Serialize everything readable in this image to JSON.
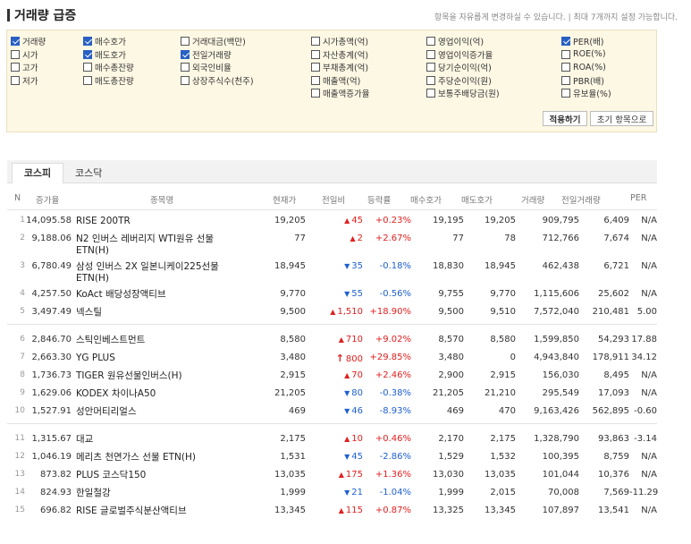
{
  "header": {
    "title": "거래량 급증",
    "hint": "항목을 자유롭게 변경하실 수 있습니다.  |  최대 7개까지 설정 가능합니다."
  },
  "filters": {
    "columns": [
      [
        {
          "label": "거래량",
          "checked": true
        },
        {
          "label": "시가",
          "checked": false
        },
        {
          "label": "고가",
          "checked": false
        },
        {
          "label": "저가",
          "checked": false
        }
      ],
      [
        {
          "label": "매수호가",
          "checked": true
        },
        {
          "label": "매도호가",
          "checked": true
        },
        {
          "label": "매수총잔량",
          "checked": false
        },
        {
          "label": "매도총잔량",
          "checked": false
        }
      ],
      [
        {
          "label": "거래대금(백만)",
          "checked": false
        },
        {
          "label": "전일거래량",
          "checked": true
        },
        {
          "label": "외국인비율",
          "checked": false
        },
        {
          "label": "상장주식수(천주)",
          "checked": false
        }
      ],
      [
        {
          "label": "시가총액(억)",
          "checked": false
        },
        {
          "label": "자산총계(억)",
          "checked": false
        },
        {
          "label": "부채총계(억)",
          "checked": false
        },
        {
          "label": "매출액(억)",
          "checked": false
        },
        {
          "label": "매출액증가율",
          "checked": false
        }
      ],
      [
        {
          "label": "영업이익(억)",
          "checked": false
        },
        {
          "label": "영업이익증가율",
          "checked": false
        },
        {
          "label": "당기순이익(억)",
          "checked": false
        },
        {
          "label": "주당순이익(원)",
          "checked": false
        },
        {
          "label": "보통주배당금(원)",
          "checked": false
        }
      ],
      [
        {
          "label": "PER(배)",
          "checked": true
        },
        {
          "label": "ROE(%)",
          "checked": false
        },
        {
          "label": "ROA(%)",
          "checked": false
        },
        {
          "label": "PBR(배)",
          "checked": false
        },
        {
          "label": "유보율(%)",
          "checked": false
        }
      ]
    ],
    "apply_label": "적용하기",
    "reset_label": "초기 항목으로"
  },
  "tabs": [
    {
      "label": "코스피",
      "active": true
    },
    {
      "label": "코스닥",
      "active": false
    }
  ],
  "table": {
    "headers": {
      "n": "N",
      "rate": "증가율",
      "name": "종목명",
      "price": "현재가",
      "chg": "전일비",
      "pct": "등락률",
      "bid": "매수호가",
      "ask": "매도호가",
      "vol": "거래량",
      "pvol": "전일거래량",
      "per": "PER"
    },
    "rows": [
      {
        "n": "1",
        "rate": "14,095.58",
        "name": "RISE 200TR",
        "price": "19,205",
        "dir": "up",
        "chg": "45",
        "pct": "+0.23%",
        "bid": "19,195",
        "ask": "19,205",
        "vol": "909,795",
        "pvol": "6,409",
        "per": "N/A"
      },
      {
        "n": "2",
        "rate": "9,188.06",
        "name": "N2 인버스 레버리지 WTI원유 선물 ETN(H)",
        "price": "77",
        "dir": "up",
        "chg": "2",
        "pct": "+2.67%",
        "bid": "77",
        "ask": "78",
        "vol": "712,766",
        "pvol": "7,674",
        "per": "N/A"
      },
      {
        "n": "3",
        "rate": "6,780.49",
        "name": "삼성 인버스 2X 일본니케이225선물 ETN(H)",
        "price": "18,945",
        "dir": "down",
        "chg": "35",
        "pct": "-0.18%",
        "bid": "18,830",
        "ask": "18,945",
        "vol": "462,438",
        "pvol": "6,721",
        "per": "N/A"
      },
      {
        "n": "4",
        "rate": "4,257.50",
        "name": "KoAct 배당성장액티브",
        "price": "9,770",
        "dir": "down",
        "chg": "55",
        "pct": "-0.56%",
        "bid": "9,755",
        "ask": "9,770",
        "vol": "1,115,606",
        "pvol": "25,602",
        "per": "N/A"
      },
      {
        "n": "5",
        "rate": "3,497.49",
        "name": "넥스틸",
        "price": "9,500",
        "dir": "up",
        "chg": "1,510",
        "pct": "+18.90%",
        "bid": "9,500",
        "ask": "9,510",
        "vol": "7,572,040",
        "pvol": "210,481",
        "per": "5.00"
      },
      {
        "n": "6",
        "rate": "2,846.70",
        "name": "스틱인베스트먼트",
        "price": "8,580",
        "dir": "up",
        "chg": "710",
        "pct": "+9.02%",
        "bid": "8,570",
        "ask": "8,580",
        "vol": "1,599,850",
        "pvol": "54,293",
        "per": "17.88"
      },
      {
        "n": "7",
        "rate": "2,663.30",
        "name": "YG PLUS",
        "price": "3,480",
        "dir": "limit",
        "chg": "800",
        "pct": "+29.85%",
        "bid": "3,480",
        "ask": "0",
        "vol": "4,943,840",
        "pvol": "178,911",
        "per": "34.12"
      },
      {
        "n": "8",
        "rate": "1,736.73",
        "name": "TIGER 원유선물인버스(H)",
        "price": "2,915",
        "dir": "up",
        "chg": "70",
        "pct": "+2.46%",
        "bid": "2,900",
        "ask": "2,915",
        "vol": "156,030",
        "pvol": "8,495",
        "per": "N/A"
      },
      {
        "n": "9",
        "rate": "1,629.06",
        "name": "KODEX 차이나A50",
        "price": "21,205",
        "dir": "down",
        "chg": "80",
        "pct": "-0.38%",
        "bid": "21,205",
        "ask": "21,210",
        "vol": "295,549",
        "pvol": "17,093",
        "per": "N/A"
      },
      {
        "n": "10",
        "rate": "1,527.91",
        "name": "성안머티리얼스",
        "price": "469",
        "dir": "down",
        "chg": "46",
        "pct": "-8.93%",
        "bid": "469",
        "ask": "470",
        "vol": "9,163,426",
        "pvol": "562,895",
        "per": "-0.60"
      },
      {
        "n": "11",
        "rate": "1,315.67",
        "name": "대교",
        "price": "2,175",
        "dir": "up",
        "chg": "10",
        "pct": "+0.46%",
        "bid": "2,170",
        "ask": "2,175",
        "vol": "1,328,790",
        "pvol": "93,863",
        "per": "-3.14"
      },
      {
        "n": "12",
        "rate": "1,046.19",
        "name": "메리츠 천연가스 선물 ETN(H)",
        "price": "1,531",
        "dir": "down",
        "chg": "45",
        "pct": "-2.86%",
        "bid": "1,529",
        "ask": "1,532",
        "vol": "100,395",
        "pvol": "8,759",
        "per": "N/A"
      },
      {
        "n": "13",
        "rate": "873.82",
        "name": "PLUS 코스닥150",
        "price": "13,035",
        "dir": "up",
        "chg": "175",
        "pct": "+1.36%",
        "bid": "13,030",
        "ask": "13,035",
        "vol": "101,044",
        "pvol": "10,376",
        "per": "N/A"
      },
      {
        "n": "14",
        "rate": "824.93",
        "name": "한일철강",
        "price": "1,999",
        "dir": "down",
        "chg": "21",
        "pct": "-1.04%",
        "bid": "1,999",
        "ask": "2,015",
        "vol": "70,008",
        "pvol": "7,569",
        "per": "-11.29"
      },
      {
        "n": "15",
        "rate": "696.82",
        "name": "RISE 글로벌주식분산액티브",
        "price": "13,345",
        "dir": "up",
        "chg": "115",
        "pct": "+0.87%",
        "bid": "13,325",
        "ask": "13,345",
        "vol": "107,897",
        "pvol": "13,541",
        "per": "N/A"
      }
    ]
  },
  "colors": {
    "up": "#e02020",
    "down": "#2060d0",
    "checkbox_on": "#2860c4",
    "filter_bg": "#fdf8e4"
  }
}
